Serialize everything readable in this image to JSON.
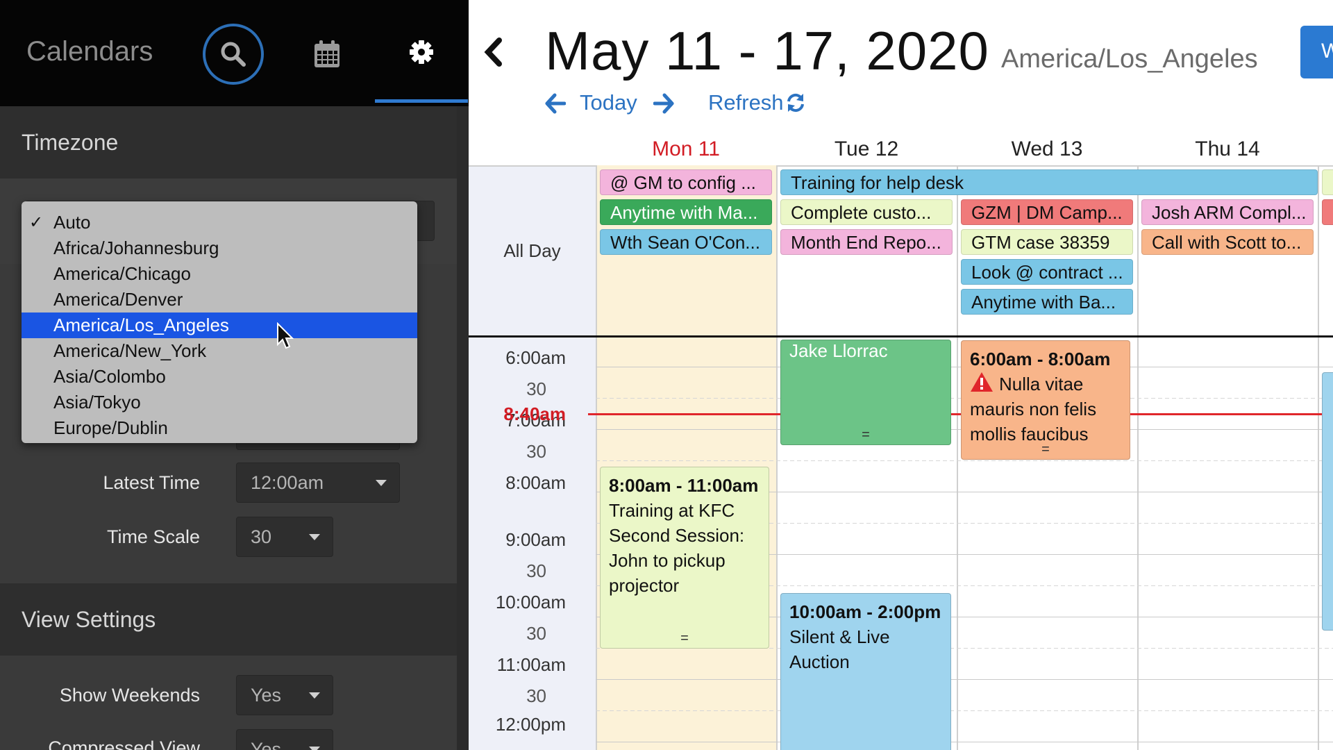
{
  "sidebar": {
    "app_title": "Calendars",
    "tabs": [
      {
        "name": "search-tab",
        "icon": "search-icon"
      },
      {
        "name": "calendar-tab",
        "icon": "calendar-icon"
      },
      {
        "name": "settings-tab",
        "icon": "gear-icon",
        "active": true
      }
    ],
    "timezone_section": {
      "title": "Timezone"
    },
    "timezone_dropdown": {
      "selected": "America/Los_Angeles",
      "checked": "Auto",
      "options": [
        "Auto",
        "Africa/Johannesburg",
        "America/Chicago",
        "America/Denver",
        "America/Los_Angeles",
        "America/New_York",
        "Asia/Colombo",
        "Asia/Tokyo",
        "Europe/Dublin"
      ]
    },
    "latest_time": {
      "label": "Latest Time",
      "value": "12:00am"
    },
    "time_scale": {
      "label": "Time Scale",
      "value": "30"
    },
    "view_settings": {
      "title": "View Settings"
    },
    "show_weekends": {
      "label": "Show Weekends",
      "value": "Yes"
    },
    "compressed_view": {
      "label": "Compressed View",
      "value": "Yes"
    }
  },
  "header": {
    "date_range": "May 11 - 17, 2020",
    "timezone": "America/Los_Angeles",
    "view_button": "W",
    "today_label": "Today",
    "refresh_label": "Refresh"
  },
  "days": [
    "Mon 11",
    "Tue 12",
    "Wed 13",
    "Thu 14"
  ],
  "today_index": 0,
  "all_day_label": "All Day",
  "time_labels": {
    "t600": "6:00am",
    "t630": "30",
    "t700": "7:00am",
    "t730": "30",
    "t800": "8:00am",
    "now": "8:40am",
    "t900": "9:00am",
    "t930": "30",
    "t1000": "10:00am",
    "t1030": "30",
    "t1100": "11:00am",
    "t1130": "30",
    "t1200": "12:00pm"
  },
  "all_day_events": {
    "mon": [
      "@ GM to config ...",
      "Anytime with Ma...",
      "Wth Sean O'Con..."
    ],
    "tue_span": "Training for help desk",
    "tue": [
      "Complete custo...",
      "Month End Repo..."
    ],
    "wed": [
      "GZM | DM Camp...",
      "GTM case 38359",
      "Look @ contract ...",
      "Anytime with Ba..."
    ],
    "thu": [
      "Josh ARM Compl...",
      "Call with Scott to..."
    ]
  },
  "timed_events": {
    "tue_early": {
      "title": "Jake Llorrac"
    },
    "wed_early": {
      "time": "6:00am - 8:00am",
      "text": "Nulla vitae mauris non felis mollis faucibus"
    },
    "mon_training": {
      "time": "8:00am - 11:00am",
      "text": "Training at KFC Second Session: John to pickup projector"
    },
    "tue_auction": {
      "time": "10:00am - 2:00pm",
      "text": "Silent & Live Auction"
    }
  },
  "colors": {
    "accent": "#2b7ad2",
    "selected": "#1a55e3",
    "now": "#e0262b",
    "pink": "#f3b4dc",
    "green": "#3aa95a",
    "blue": "#7ac6e6",
    "lightgreen": "#ebf7c8",
    "red": "#f07a7a",
    "orange": "#f8b58a",
    "mint": "#6cc487",
    "sky": "#9fd4ee"
  }
}
